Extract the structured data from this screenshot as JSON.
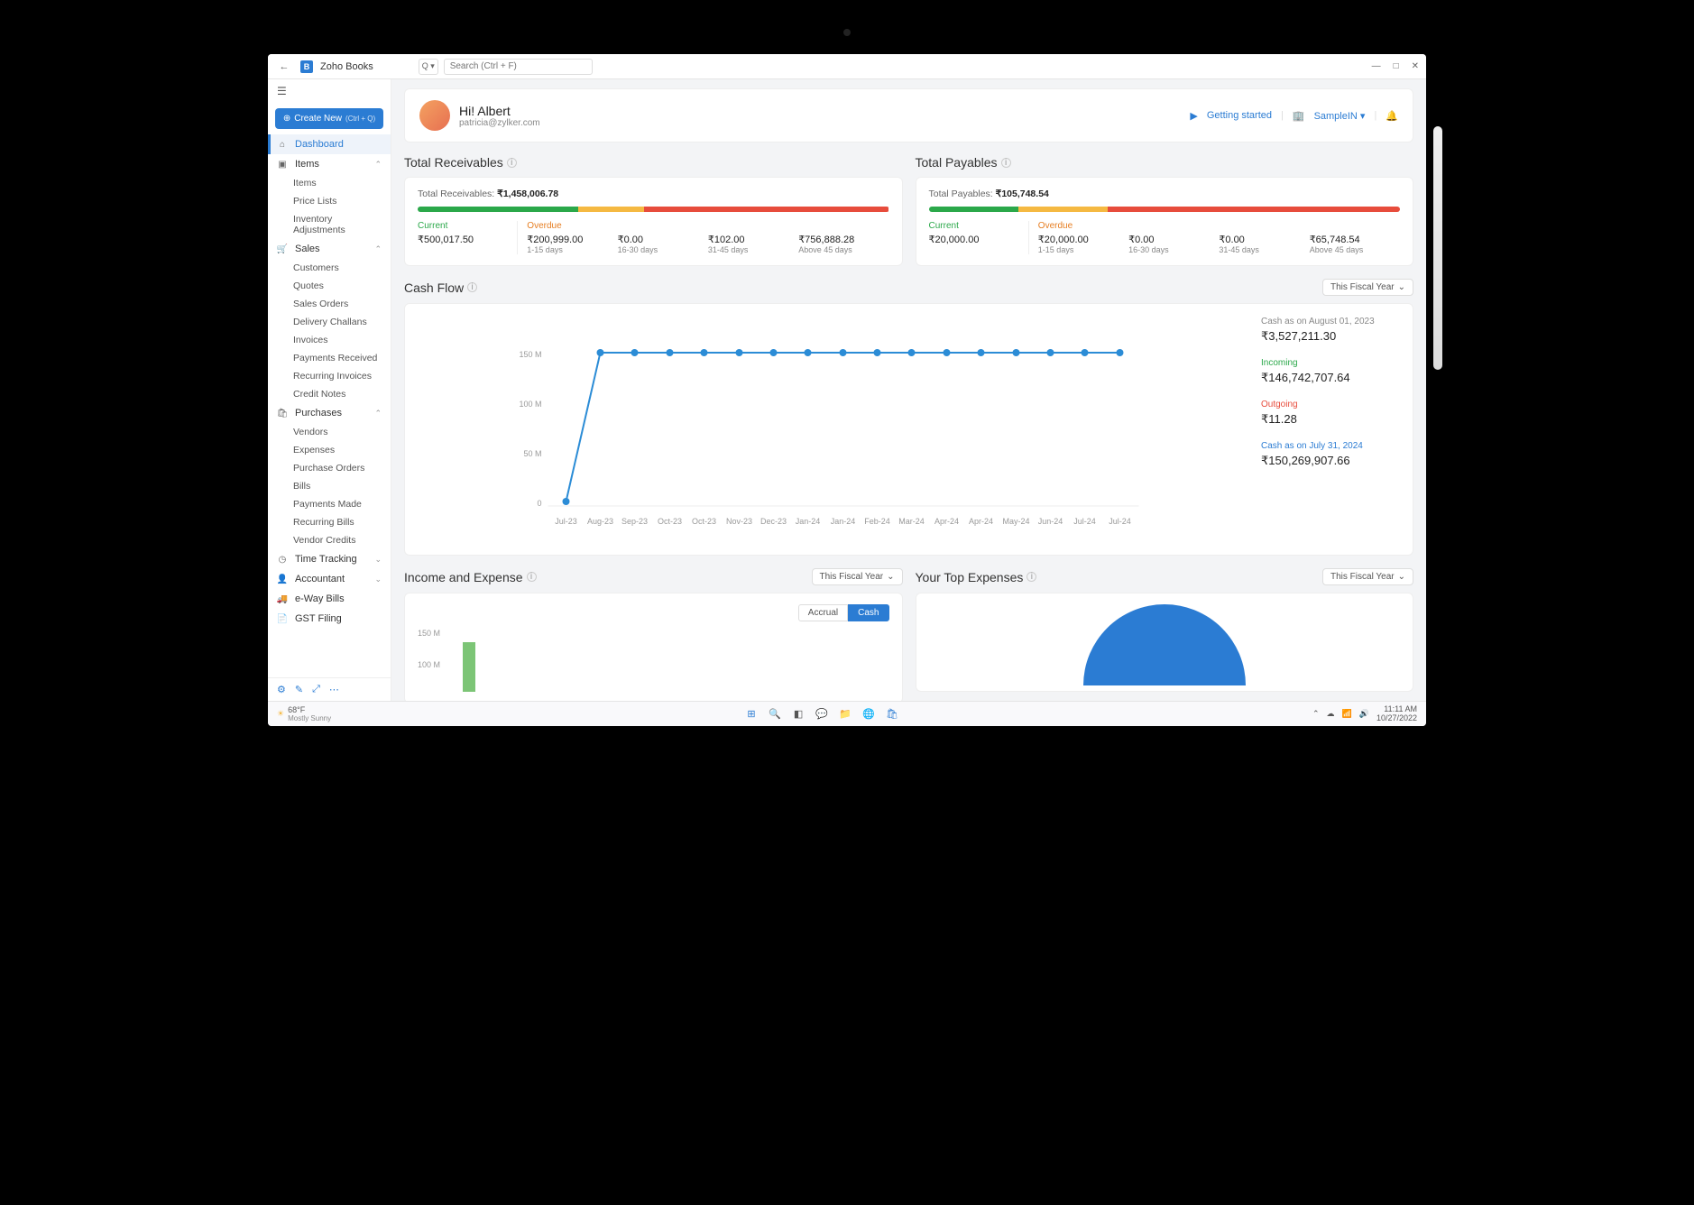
{
  "titlebar": {
    "app_name": "Zoho Books",
    "search_placeholder": "Search (Ctrl + F)",
    "search_dd": "Q ▾"
  },
  "create_btn": {
    "label": "Create New",
    "kbd": "(Ctrl + Q)"
  },
  "sidebar": {
    "dashboard": "Dashboard",
    "items": {
      "label": "Items",
      "children": [
        "Items",
        "Price Lists",
        "Inventory Adjustments"
      ]
    },
    "sales": {
      "label": "Sales",
      "children": [
        "Customers",
        "Quotes",
        "Sales Orders",
        "Delivery Challans",
        "Invoices",
        "Payments Received",
        "Recurring Invoices",
        "Credit Notes"
      ]
    },
    "purchases": {
      "label": "Purchases",
      "children": [
        "Vendors",
        "Expenses",
        "Purchase Orders",
        "Bills",
        "Payments Made",
        "Recurring Bills",
        "Vendor Credits"
      ]
    },
    "time_tracking": "Time Tracking",
    "accountant": "Accountant",
    "eway": "e-Way Bills",
    "gst": "GST Filing"
  },
  "greeting": {
    "hi": "Hi! Albert",
    "email": "patricia@zylker.com",
    "getting_started": "Getting started",
    "sample": "SampleIN ▾"
  },
  "receivables": {
    "title": "Total Receivables",
    "total_label": "Total Receivables:",
    "total_value": "₹1,458,006.78",
    "current": {
      "label": "Current",
      "value": "₹500,017.50"
    },
    "overdue_label": "Overdue",
    "buckets": [
      {
        "value": "₹200,999.00",
        "sub": "1-15 days"
      },
      {
        "value": "₹0.00",
        "sub": "16-30 days"
      },
      {
        "value": "₹102.00",
        "sub": "31-45 days"
      },
      {
        "value": "₹756,888.28",
        "sub": "Above 45 days"
      }
    ]
  },
  "payables": {
    "title": "Total Payables",
    "total_label": "Total Payables:",
    "total_value": "₹105,748.54",
    "current": {
      "label": "Current",
      "value": "₹20,000.00"
    },
    "overdue_label": "Overdue",
    "buckets": [
      {
        "value": "₹20,000.00",
        "sub": "1-15 days"
      },
      {
        "value": "₹0.00",
        "sub": "16-30 days"
      },
      {
        "value": "₹0.00",
        "sub": "31-45 days"
      },
      {
        "value": "₹65,748.54",
        "sub": "Above 45 days"
      }
    ]
  },
  "cashflow": {
    "title": "Cash Flow",
    "range": "This Fiscal Year",
    "as_on_start_lbl": "Cash as on  August 01, 2023",
    "as_on_start_val": "₹3,527,211.30",
    "incoming_lbl": "Incoming",
    "incoming_val": "₹146,742,707.64",
    "outgoing_lbl": "Outgoing",
    "outgoing_val": "₹11.28",
    "as_on_end_lbl": "Cash as on  July 31, 2024",
    "as_on_end_val": "₹150,269,907.66"
  },
  "income_exp": {
    "title": "Income and Expense",
    "range": "This Fiscal Year",
    "accrual": "Accrual",
    "cash": "Cash"
  },
  "top_exp": {
    "title": "Your Top Expenses",
    "range": "This Fiscal Year"
  },
  "taskbar": {
    "temp": "68°F",
    "weather": "Mostly Sunny",
    "time": "11:11 AM",
    "date": "10/27/2022"
  },
  "chart_data": {
    "type": "line",
    "title": "Cash Flow",
    "ylabel": "",
    "ylim": [
      0,
      170000000
    ],
    "y_ticks": [
      "0",
      "50 M",
      "100 M",
      "150 M"
    ],
    "categories": [
      "Jul-23",
      "Aug-23",
      "Sep-23",
      "Oct-23",
      "Oct-23",
      "Nov-23",
      "Dec-23",
      "Jan-24",
      "Jan-24",
      "Feb-24",
      "Mar-24",
      "Apr-24",
      "Apr-24",
      "May-24",
      "Jun-24",
      "Jul-24",
      "Jul-24"
    ],
    "series": [
      {
        "name": "Cash",
        "values": [
          3527211,
          150000000,
          150000000,
          150000000,
          150000000,
          150000000,
          150000000,
          150000000,
          150000000,
          150000000,
          150000000,
          150000000,
          150000000,
          150000000,
          150000000,
          150000000,
          150000000
        ]
      }
    ]
  }
}
